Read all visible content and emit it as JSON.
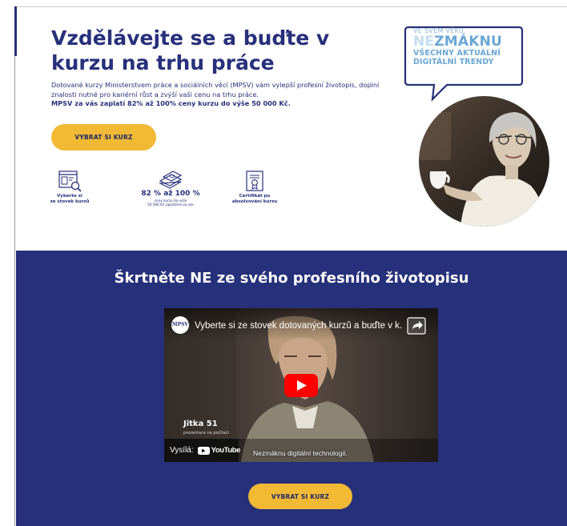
{
  "hero": {
    "title": "Vzdělávejte se a buďte v kurzu na trhu práce",
    "description": "Dotované kurzy Ministerstvem práce a sociálních věcí (MPSV) vám vylepší profesní životopis, doplní znalosti nutné pro kariérní růst a zvýší vaši cenu na trhu práce.",
    "description_bold": "MPSV za vás zaplatí 82% až 100% ceny kurzu do výše 50 000 Kč.",
    "cta_label": "VYBRAT SI KURZ"
  },
  "features": [
    {
      "icon": "course-catalog-icon",
      "label": "Vyberte si\nze stovek kurzů"
    },
    {
      "icon": "money-stack-icon",
      "headline": "82 % až 100 %",
      "label": "ceny kurzu do výše\n50 000 Kč zaplatíme za vás"
    },
    {
      "icon": "certificate-icon",
      "label": "Certifikát po\nabsolvování kurzu"
    }
  ],
  "badge": {
    "line1": "VE SVÉM VĚKU",
    "line2_highlight": "NE",
    "line2_rest": "ZMÁKNU",
    "line3": "VŠECHNY AKTUÁLNÍ",
    "line4": "DIGITÁLNÍ TRENDY"
  },
  "section": {
    "title": "Škrtněte NE ze svého profesního životopisu",
    "cta_label": "VYBRAT SI KURZ"
  },
  "video": {
    "channel_logo_text": "MPSV",
    "title": "Vyberte si ze stovek dotovaných kurzů a buďte v k...",
    "person_name": "Jitka 51",
    "person_sub": "prezentace na počítači",
    "watch_label": "Vysílá:",
    "youtube_label": "YouTube",
    "caption": "Nezmáknu digitální technologii."
  },
  "colors": {
    "navy": "#27307a",
    "yellow": "#f1b934",
    "light_blue": "#6aa7d4",
    "youtube_red": "#ff0000"
  }
}
